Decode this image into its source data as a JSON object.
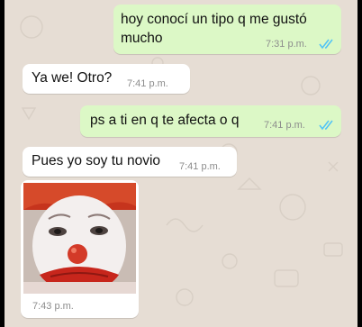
{
  "colors": {
    "outgoing_bubble": "#dcf8c6",
    "incoming_bubble": "#ffffff",
    "wallpaper": "#e6ddd4",
    "read_tick": "#4fc3f7"
  },
  "messages": [
    {
      "direction": "outgoing",
      "lines": [
        "hoy conocí un tipo q me gustó",
        "mucho"
      ],
      "time": "7:31 p.m.",
      "status": "read"
    },
    {
      "direction": "incoming",
      "text": "Ya we! Otro?",
      "time": "7:41 p.m."
    },
    {
      "direction": "outgoing",
      "text": "ps a ti en q te afecta o q",
      "time": "7:41 p.m.",
      "status": "read"
    },
    {
      "direction": "incoming",
      "text": "Pues yo soy tu novio",
      "time": "7:41 p.m."
    },
    {
      "direction": "incoming",
      "type": "image",
      "image_subject": "clown-face",
      "time": "7:43 p.m."
    }
  ]
}
